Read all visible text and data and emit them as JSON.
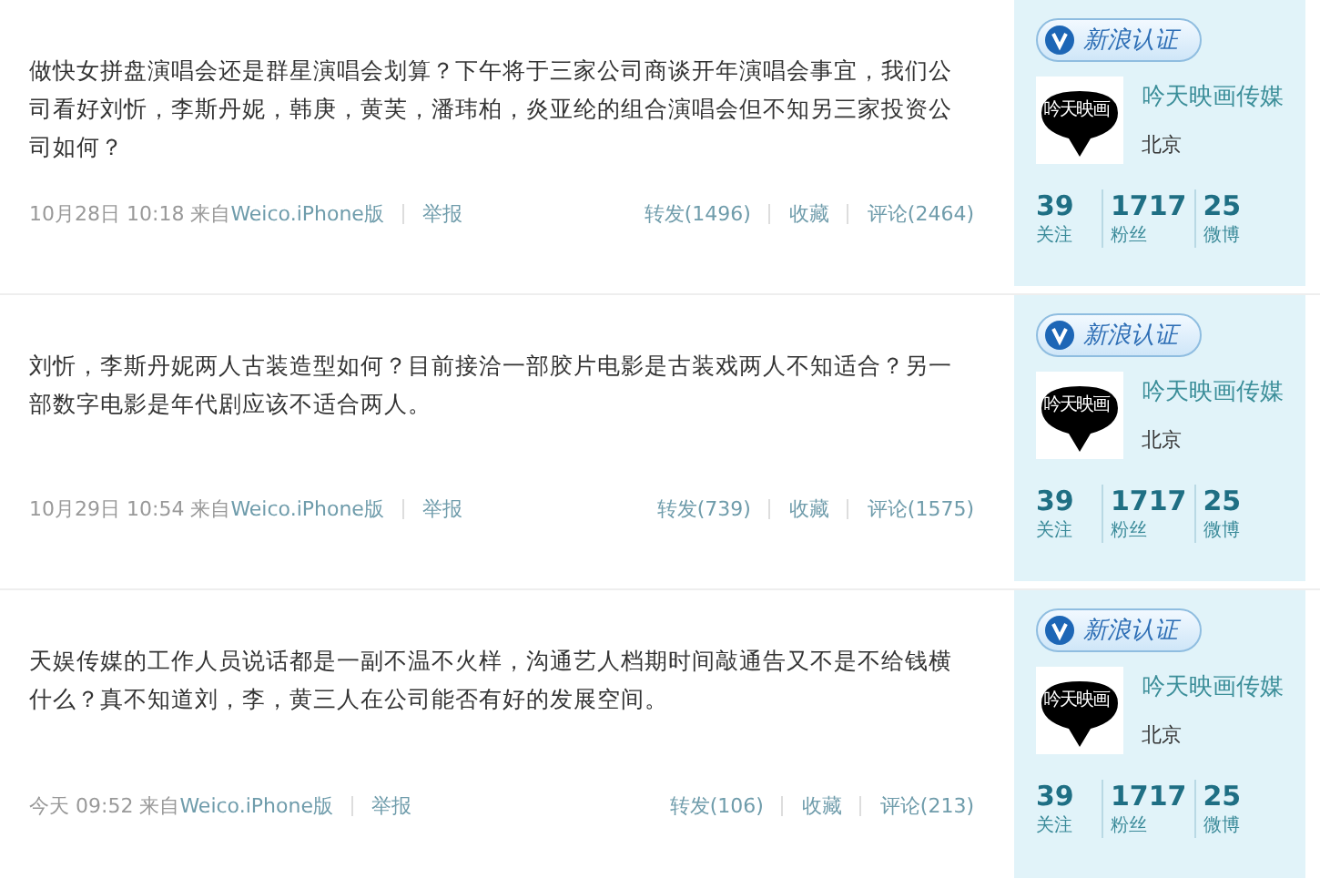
{
  "posts": [
    {
      "text": "做快女拼盘演唱会还是群星演唱会划算？下午将于三家公司商谈开年演唱会事宜，我们公司看好刘忻，李斯丹妮，韩庚，黄芙，潘玮柏，炎亚纶的组合演唱会但不知另三家投资公司如何？",
      "posted": "10月28日  10:18 来自",
      "source": "Weico.iPhone版",
      "report": "举报",
      "actions": [
        "转发(1496)",
        "收藏",
        "评论(2464)"
      ],
      "card": {
        "badge": "新浪认证",
        "logo_text": "吟天映画",
        "name": "吟天映画传媒",
        "city": "北京",
        "stats": [
          {
            "value": "39",
            "label": "关注"
          },
          {
            "value": "1717",
            "label": "粉丝"
          },
          {
            "value": "25",
            "label": "微博"
          }
        ]
      }
    },
    {
      "text": "刘忻，李斯丹妮两人古装造型如何？目前接洽一部胶片电影是古装戏两人不知适合？另一部数字电影是年代剧应该不适合两人。",
      "posted": "10月29日  10:54 来自",
      "source": "Weico.iPhone版",
      "report": "举报",
      "actions": [
        "转发(739)",
        "收藏",
        "评论(1575)"
      ],
      "card": {
        "badge": "新浪认证",
        "logo_text": "吟天映画",
        "name": "吟天映画传媒",
        "city": "北京",
        "stats": [
          {
            "value": "39",
            "label": "关注"
          },
          {
            "value": "1717",
            "label": "粉丝"
          },
          {
            "value": "25",
            "label": "微博"
          }
        ]
      }
    },
    {
      "text": "天娱传媒的工作人员说话都是一副不温不火样，沟通艺人档期时间敲通告又不是不给钱横什么？真不知道刘，李，黄三人在公司能否有好的发展空间。",
      "posted": "今天  09:52 来自",
      "source": "Weico.iPhone版",
      "report": "举报",
      "actions": [
        "转发(106)",
        "收藏",
        "评论(213)"
      ],
      "card": {
        "badge": "新浪认证",
        "logo_text": "吟天映画",
        "name": "吟天映画传媒",
        "city": "北京",
        "stats": [
          {
            "value": "39",
            "label": "关注"
          },
          {
            "value": "1717",
            "label": "粉丝"
          },
          {
            "value": "25",
            "label": "微博"
          }
        ]
      }
    }
  ]
}
